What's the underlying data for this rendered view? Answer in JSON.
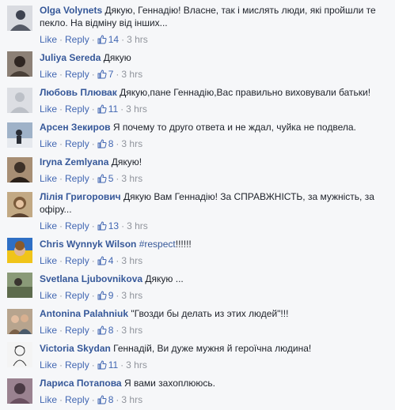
{
  "actions": {
    "like": "Like",
    "reply": "Reply",
    "dot": "·"
  },
  "comments": [
    {
      "author": "Olga Volynets",
      "text": "Дякую, Геннадію! Власне, так і мислять люди, які пройшли те пекло. На відміну від інших...",
      "likes": "14",
      "time": "3 hrs",
      "avatar_color": "#555a66"
    },
    {
      "author": "Juliya Sereda",
      "text": "Дякую",
      "likes": "7",
      "time": "3 hrs",
      "avatar_color": "#4a4038"
    },
    {
      "author": "Любовь Плювак",
      "text": "Дякую,пане Геннадію,Вас правильно виховували батьки!",
      "likes": "11",
      "time": "3 hrs",
      "avatar_color": "#c9ccd1"
    },
    {
      "author": "Арсен Зекиров",
      "text": "Я почему то друго ответа и не ждал, чуйка не подвела.",
      "likes": "8",
      "time": "3 hrs",
      "avatar_color": "#5a6e88"
    },
    {
      "author": "Iryna Zemlyana",
      "text": "Дякую!",
      "likes": "5",
      "time": "3 hrs",
      "avatar_color": "#3d3128"
    },
    {
      "author": "Лілія Григорович",
      "text": "Дякую Вам Геннадію! За СПРАВЖНІСТЬ, за мужність, за офіру...",
      "likes": "13",
      "time": "3 hrs",
      "avatar_color": "#7a5a3a"
    },
    {
      "author": "Chris Wynnyk Wilson",
      "text": "!!!!!!",
      "hashtag": "#respect",
      "likes": "4",
      "time": "3 hrs",
      "avatar_color": "#c8a23c"
    },
    {
      "author": "Svetlana Ljubovnikova",
      "text": "Дякую ...",
      "likes": "9",
      "time": "3 hrs",
      "avatar_color": "#6b7a5a"
    },
    {
      "author": "Antonina Palahniuk",
      "text": "\"Гвозди бы делать из этих людей\"!!!",
      "likes": "8",
      "time": "3 hrs",
      "avatar_color": "#7a6048"
    },
    {
      "author": "Victoria Skydan",
      "text": "Геннадій, Ви дуже мужня й героїчна людина!",
      "likes": "11",
      "time": "3 hrs",
      "avatar_color": "#e8e8e8"
    },
    {
      "author": "Лариса Потапова",
      "text": "Я вами захоплююсь.",
      "likes": "8",
      "time": "3 hrs",
      "avatar_color": "#6a5060"
    }
  ]
}
